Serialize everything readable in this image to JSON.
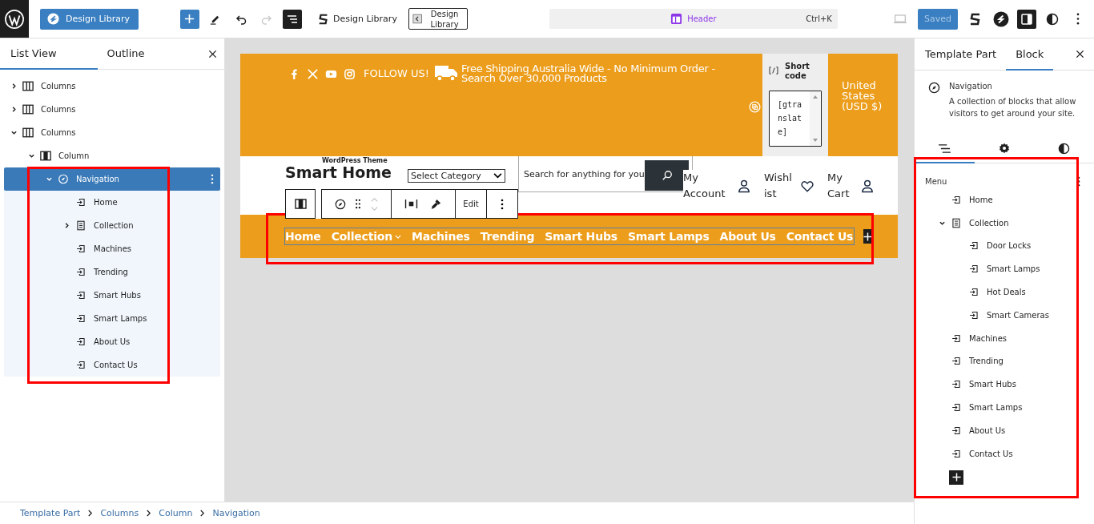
{
  "top_bar": {
    "design_library_button": "Design Library",
    "redo": {
      "disabled": true
    },
    "list_view_toggle": {
      "pressed": true
    },
    "design_library_link": "Design Library",
    "design_library_block": "Design Library",
    "document_title": "Header",
    "shortcut": "Ctrl+K",
    "save_button": {
      "label": "Saved",
      "disabled": true
    },
    "settings_toggle": {
      "pressed": true
    }
  },
  "list_view": {
    "tabs": [
      {
        "label": "List View",
        "selected": true
      },
      {
        "label": "Outline",
        "selected": false
      }
    ],
    "tree": [
      {
        "label": "Columns",
        "kind": "columns",
        "expanded": false,
        "selected": false
      },
      {
        "label": "Columns",
        "kind": "columns",
        "expanded": false,
        "selected": false
      },
      {
        "label": "Columns",
        "kind": "columns",
        "expanded": true,
        "selected": false,
        "children": [
          {
            "label": "Column",
            "kind": "column",
            "expanded": true,
            "selected": false,
            "children": [
              {
                "label": "Navigation",
                "kind": "navigation",
                "expanded": true,
                "selected": true,
                "children": [
                  {
                    "label": "Home",
                    "kind": "link",
                    "selected": false
                  },
                  {
                    "label": "Collection",
                    "kind": "page",
                    "expanded": false,
                    "selected": false
                  },
                  {
                    "label": "Machines",
                    "kind": "link",
                    "selected": false
                  },
                  {
                    "label": "Trending",
                    "kind": "link",
                    "selected": false
                  },
                  {
                    "label": "Smart Hubs",
                    "kind": "link",
                    "selected": false
                  },
                  {
                    "label": "Smart Lamps",
                    "kind": "link",
                    "selected": false
                  },
                  {
                    "label": "About Us",
                    "kind": "link",
                    "selected": false
                  },
                  {
                    "label": "Contact Us",
                    "kind": "link",
                    "selected": false
                  }
                ]
              }
            ]
          }
        ]
      }
    ]
  },
  "canvas": {
    "follow_label": "FOLLOW US!",
    "shipping_lines": [
      "Free Shipping Australia Wide - No Minimum Order -",
      "Search Over 30,000 Products"
    ],
    "shortcode": {
      "title": "Shortcode",
      "value": "[gtranslate]"
    },
    "currency": "United States (USD $)",
    "logo": {
      "tagline": "WordPress Theme",
      "title": "Smart Home"
    },
    "category_select": "Select Category",
    "search": {
      "placeholder": "Search for anything for you"
    },
    "account_links": [
      {
        "label": "My Account",
        "kind": "user"
      },
      {
        "label": "Wishlist",
        "kind": "heart"
      },
      {
        "label": "My Cart",
        "kind": "user"
      }
    ],
    "block_toolbar": {
      "edit": "Edit"
    },
    "nav": [
      {
        "label": "Home",
        "has_submenu": false
      },
      {
        "label": "Collection",
        "has_submenu": true
      },
      {
        "label": "Machines",
        "has_submenu": false
      },
      {
        "label": "Trending",
        "has_submenu": false
      },
      {
        "label": "Smart Hubs",
        "has_submenu": false
      },
      {
        "label": "Smart Lamps",
        "has_submenu": false
      },
      {
        "label": "About Us",
        "has_submenu": false
      },
      {
        "label": "Contact Us",
        "has_submenu": false
      }
    ]
  },
  "breadcrumbs": [
    "Template Part",
    "Columns",
    "Column",
    "Navigation"
  ],
  "inspector": {
    "tabs": [
      {
        "label": "Template Part",
        "selected": false
      },
      {
        "label": "Block",
        "selected": true
      }
    ],
    "block": {
      "title": "Navigation",
      "description": "A collection of blocks that allow visitors to get around your site."
    },
    "panel_tabs": [
      {
        "kind": "list",
        "selected": true
      },
      {
        "kind": "settings",
        "selected": false
      },
      {
        "kind": "styles",
        "selected": false
      }
    ],
    "menu_title": "Menu",
    "menu": [
      {
        "label": "Home",
        "kind": "link"
      },
      {
        "label": "Collection",
        "kind": "page",
        "expanded": true,
        "children": [
          {
            "label": "Door Locks",
            "kind": "link"
          },
          {
            "label": "Smart Lamps",
            "kind": "link"
          },
          {
            "label": "Hot Deals",
            "kind": "link"
          },
          {
            "label": "Smart Cameras",
            "kind": "link"
          }
        ]
      },
      {
        "label": "Machines",
        "kind": "link"
      },
      {
        "label": "Trending",
        "kind": "link"
      },
      {
        "label": "Smart Hubs",
        "kind": "link"
      },
      {
        "label": "Smart Lamps",
        "kind": "link"
      },
      {
        "label": "About Us",
        "kind": "link"
      },
      {
        "label": "Contact Us",
        "kind": "link"
      }
    ]
  }
}
